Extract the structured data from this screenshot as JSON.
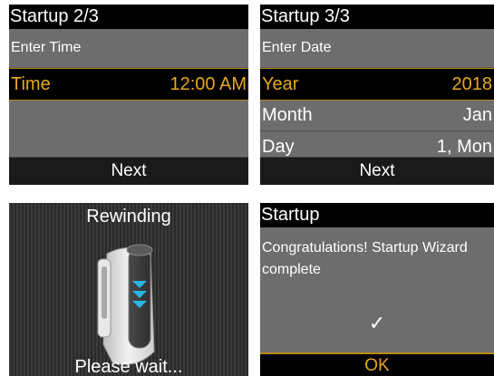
{
  "screens": {
    "time": {
      "title": "Startup 2/3",
      "subtitle": "Enter Time",
      "row_label": "Time",
      "row_value": "12:00 AM",
      "footer": "Next"
    },
    "date": {
      "title": "Startup 3/3",
      "subtitle": "Enter Date",
      "rows": [
        {
          "label": "Year",
          "value": "2018"
        },
        {
          "label": "Month",
          "value": "Jan"
        },
        {
          "label": "Day",
          "value": "1, Mon"
        }
      ],
      "footer": "Next"
    },
    "rewind": {
      "title": "Rewinding",
      "status": "Please wait..."
    },
    "complete": {
      "title": "Startup",
      "message": "Congratulations! Startup Wizard complete",
      "check": "✓",
      "footer": "OK"
    }
  },
  "colors": {
    "accent": "#e6a817",
    "background": "#6d6d6d",
    "bar": "#000000"
  },
  "icons": {
    "pump": "insulin-pump-icon",
    "arrows": "rewind-arrows-icon",
    "check": "check-icon"
  }
}
